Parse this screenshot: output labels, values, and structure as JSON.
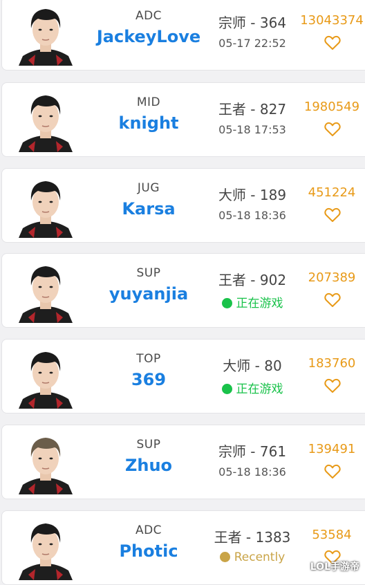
{
  "colors": {
    "name_blue": "#1a7fe0",
    "score_orange": "#e89a18",
    "online_green": "#19c24a",
    "recent_gold": "#c9a447"
  },
  "players": [
    {
      "role": "ADC",
      "name": "JackeyLove",
      "rank": "宗师 - 364",
      "time": "05-17 22:52",
      "status": "",
      "score": "13043374",
      "hair": "#1b1b1b"
    },
    {
      "role": "MID",
      "name": "knight",
      "rank": "王者 - 827",
      "time": "05-18 17:53",
      "status": "",
      "score": "1980549",
      "hair": "#1b1b1b"
    },
    {
      "role": "JUG",
      "name": "Karsa",
      "rank": "大师 - 189",
      "time": "05-18 18:36",
      "status": "",
      "score": "451224",
      "hair": "#1b1b1b"
    },
    {
      "role": "SUP",
      "name": "yuyanjia",
      "rank": "王者 - 902",
      "time": "",
      "status": "正在游戏",
      "status_type": "online",
      "score": "207389",
      "hair": "#1b1b1b"
    },
    {
      "role": "TOP",
      "name": "369",
      "rank": "大师 - 80",
      "time": "",
      "status": "正在游戏",
      "status_type": "online",
      "score": "183760",
      "hair": "#1b1b1b"
    },
    {
      "role": "SUP",
      "name": "Zhuo",
      "rank": "宗师 - 761",
      "time": "05-18 18:36",
      "status": "",
      "score": "139491",
      "hair": "#6b5d4a"
    },
    {
      "role": "ADC",
      "name": "Photic",
      "rank": "王者 - 1383",
      "time": "",
      "status": "Recently",
      "status_type": "recent",
      "score": "53584",
      "hair": "#1b1b1b"
    }
  ],
  "watermark": "LOL手游帝"
}
